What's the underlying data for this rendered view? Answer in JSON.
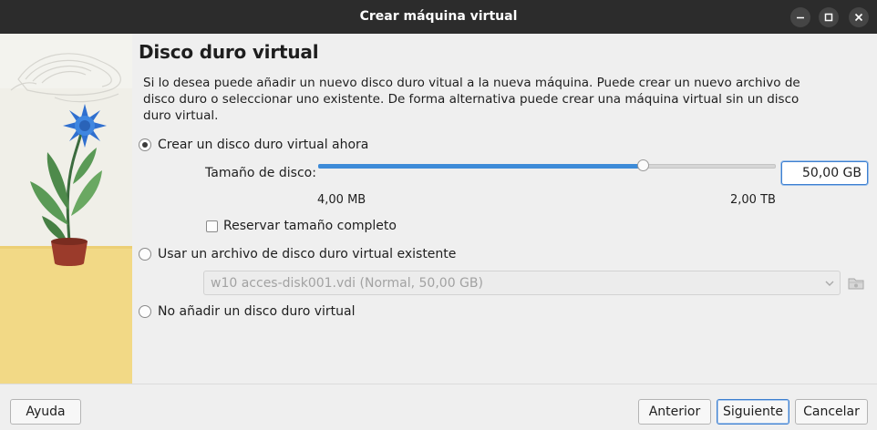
{
  "window": {
    "title": "Crear máquina virtual"
  },
  "page": {
    "title": "Disco duro virtual",
    "description": "Si lo desea puede añadir un nuevo disco duro vitual a la nueva máquina. Puede crear un nuevo archivo de disco duro o seleccionar uno existente. De forma alternativa puede crear una máquina virtual sin un disco duro virtual."
  },
  "options": {
    "create_new": {
      "label": "Crear un disco duro virtual ahora",
      "checked": true
    },
    "use_existing": {
      "label": "Usar un archivo de disco duro virtual existente",
      "checked": false
    },
    "no_disk": {
      "label": "No añadir un disco duro virtual",
      "checked": false
    }
  },
  "disk_size": {
    "label": "Tamaño de disco:",
    "value": "50,00 GB",
    "min_label": "4,00 MB",
    "max_label": "2,00 TB",
    "slider_fraction": 0.71
  },
  "preallocate": {
    "label": "Reservar tamaño completo",
    "checked": false
  },
  "existing_file": {
    "selected": "w10 acces-disk001.vdi (Normal, 50,00 GB)"
  },
  "buttons": {
    "help": "Ayuda",
    "back": "Anterior",
    "next": "Siguiente",
    "cancel": "Cancelar"
  },
  "colors": {
    "accent": "#3d8bd8",
    "titlebar": "#2c2c2c"
  },
  "icons": [
    "minimize-icon",
    "maximize-icon",
    "close-icon",
    "chevron-down-icon",
    "folder-icon"
  ]
}
